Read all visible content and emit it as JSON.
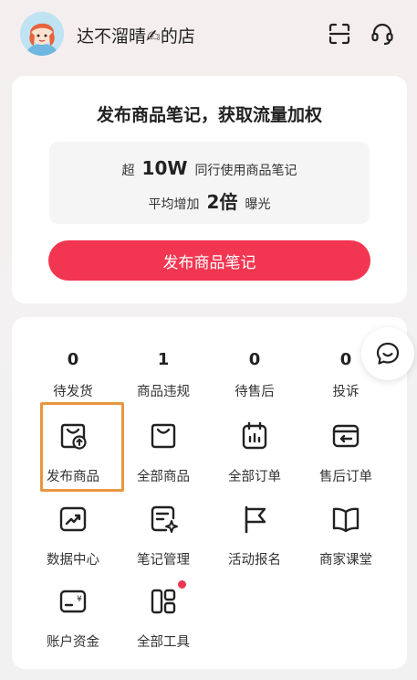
{
  "header": {
    "shop_name": "达不溜晴✍的店",
    "avatar_icon": "girl-avatar",
    "scan_icon": "scan-icon",
    "service_icon": "headset-icon"
  },
  "publish_card": {
    "title": "发布商品笔记，获取流量加权",
    "line1": {
      "prefix": "超",
      "value": "10W",
      "suffix": "同行使用商品笔记"
    },
    "line2": {
      "prefix": "平均增加",
      "value": "2倍",
      "suffix": "曝光"
    },
    "button": "发布商品笔记"
  },
  "counts": [
    {
      "value": "0",
      "label": "待发货"
    },
    {
      "value": "1",
      "label": "商品违规"
    },
    {
      "value": "0",
      "label": "待售后"
    },
    {
      "value": "0",
      "label": "投诉"
    }
  ],
  "tools": [
    {
      "label": "发布商品",
      "icon": "bag-upload-icon"
    },
    {
      "label": "全部商品",
      "icon": "bag-icon"
    },
    {
      "label": "全部订单",
      "icon": "clipboard-chart-icon"
    },
    {
      "label": "售后订单",
      "icon": "return-icon"
    },
    {
      "label": "数据中心",
      "icon": "trend-chart-icon"
    },
    {
      "label": "笔记管理",
      "icon": "note-sparkle-icon"
    },
    {
      "label": "活动报名",
      "icon": "flag-icon"
    },
    {
      "label": "商家课堂",
      "icon": "book-icon"
    },
    {
      "label": "账户资金",
      "icon": "wallet-icon"
    },
    {
      "label": "全部工具",
      "icon": "grid-tools-icon"
    }
  ],
  "colors": {
    "accent": "#f23651",
    "highlight": "#e9963f"
  },
  "float_icon": "chat-bubble-icon"
}
